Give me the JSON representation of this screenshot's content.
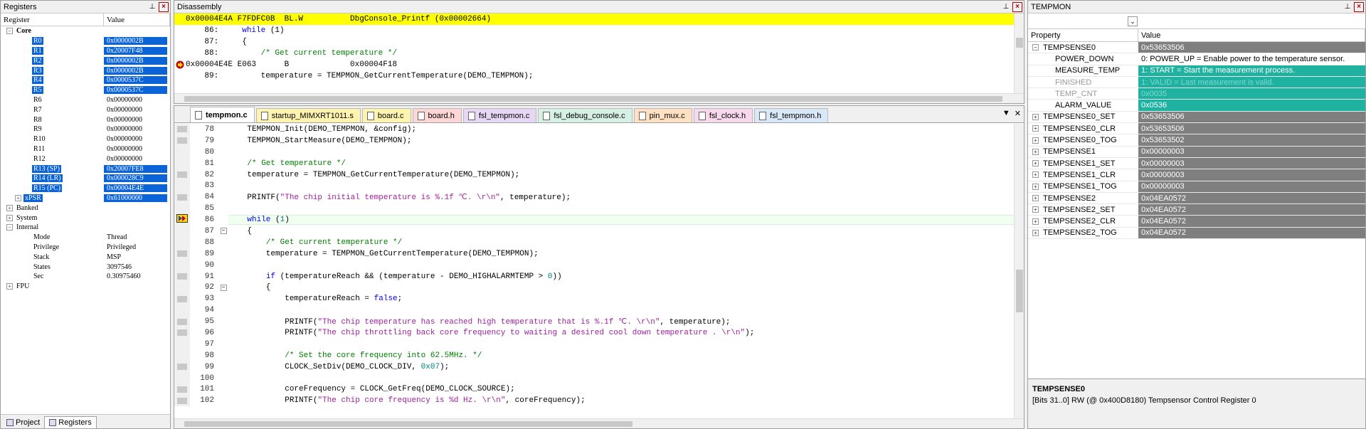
{
  "registers": {
    "title": "Registers",
    "col_register": "Register",
    "col_value": "Value",
    "rows": [
      {
        "name": "Core",
        "value": "",
        "level": 0,
        "expander": "−",
        "bold": true,
        "sel": false
      },
      {
        "name": "R0",
        "value": "0x0000002B",
        "level": 2,
        "expander": "",
        "sel": true
      },
      {
        "name": "R1",
        "value": "0x20007F48",
        "level": 2,
        "expander": "",
        "sel": true
      },
      {
        "name": "R2",
        "value": "0x0000002B",
        "level": 2,
        "expander": "",
        "sel": true
      },
      {
        "name": "R3",
        "value": "0x0000002B",
        "level": 2,
        "expander": "",
        "sel": true
      },
      {
        "name": "R4",
        "value": "0x0000537C",
        "level": 2,
        "expander": "",
        "sel": true
      },
      {
        "name": "R5",
        "value": "0x0000537C",
        "level": 2,
        "expander": "",
        "sel": true
      },
      {
        "name": "R6",
        "value": "0x00000000",
        "level": 2,
        "expander": "",
        "sel": false
      },
      {
        "name": "R7",
        "value": "0x00000000",
        "level": 2,
        "expander": "",
        "sel": false
      },
      {
        "name": "R8",
        "value": "0x00000000",
        "level": 2,
        "expander": "",
        "sel": false
      },
      {
        "name": "R9",
        "value": "0x00000000",
        "level": 2,
        "expander": "",
        "sel": false
      },
      {
        "name": "R10",
        "value": "0x00000000",
        "level": 2,
        "expander": "",
        "sel": false
      },
      {
        "name": "R11",
        "value": "0x00000000",
        "level": 2,
        "expander": "",
        "sel": false
      },
      {
        "name": "R12",
        "value": "0x00000000",
        "level": 2,
        "expander": "",
        "sel": false
      },
      {
        "name": "R13 (SP)",
        "value": "0x20007FE8",
        "level": 2,
        "expander": "",
        "sel": true
      },
      {
        "name": "R14 (LR)",
        "value": "0x000028C9",
        "level": 2,
        "expander": "",
        "sel": true
      },
      {
        "name": "R15 (PC)",
        "value": "0x00004E4E",
        "level": 2,
        "expander": "",
        "sel": true
      },
      {
        "name": "xPSR",
        "value": "0x61000000",
        "level": 1,
        "expander": "+",
        "sel": true
      },
      {
        "name": "Banked",
        "value": "",
        "level": 0,
        "expander": "+",
        "sel": false
      },
      {
        "name": "System",
        "value": "",
        "level": 0,
        "expander": "+",
        "sel": false
      },
      {
        "name": "Internal",
        "value": "",
        "level": 0,
        "expander": "−",
        "sel": false
      },
      {
        "name": "Mode",
        "value": "Thread",
        "level": 2,
        "expander": "",
        "sel": false
      },
      {
        "name": "Privilege",
        "value": "Privileged",
        "level": 2,
        "expander": "",
        "sel": false
      },
      {
        "name": "Stack",
        "value": "MSP",
        "level": 2,
        "expander": "",
        "sel": false
      },
      {
        "name": "States",
        "value": "3097546",
        "level": 2,
        "expander": "",
        "sel": false
      },
      {
        "name": "Sec",
        "value": "0.30975460",
        "level": 2,
        "expander": "",
        "sel": false
      },
      {
        "name": "FPU",
        "value": "",
        "level": 0,
        "expander": "+",
        "sel": false
      }
    ],
    "tab_project": "Project",
    "tab_registers": "Registers"
  },
  "disassembly": {
    "title": "Disassembly",
    "lines": [
      {
        "marker": "",
        "cur": true,
        "segments": [
          {
            "t": "0x00004E4A F7FDFC0B  BL.W          DbgConsole_Printf (0x00002664)",
            "c": ""
          }
        ]
      },
      {
        "marker": "",
        "cur": false,
        "segments": [
          {
            "t": "    86:     ",
            "c": ""
          },
          {
            "t": "while",
            "c": "kw"
          },
          {
            "t": " (1)",
            "c": ""
          }
        ]
      },
      {
        "marker": "",
        "cur": false,
        "segments": [
          {
            "t": "    87:     {",
            "c": ""
          }
        ]
      },
      {
        "marker": "",
        "cur": false,
        "segments": [
          {
            "t": "    88:         ",
            "c": ""
          },
          {
            "t": "/* Get current temperature */",
            "c": "cm"
          }
        ]
      },
      {
        "marker": "pc",
        "cur": false,
        "segments": [
          {
            "t": "0x00004E4E E063      B             0x00004F18",
            "c": ""
          }
        ]
      },
      {
        "marker": "",
        "cur": false,
        "segments": [
          {
            "t": "    89:         temperature = TEMPMON_GetCurrentTemperature(DEMO_TEMPMON);",
            "c": ""
          }
        ]
      }
    ]
  },
  "editor": {
    "tabs": [
      {
        "label": "tempmon.c",
        "color": "#ffffff",
        "active": true
      },
      {
        "label": "startup_MIMXRT1011.s",
        "color": "#fff3b0",
        "active": false
      },
      {
        "label": "board.c",
        "color": "#fff3b0",
        "active": false
      },
      {
        "label": "board.h",
        "color": "#ffd6d6",
        "active": false
      },
      {
        "label": "fsl_tempmon.c",
        "color": "#e6d8f5",
        "active": false
      },
      {
        "label": "fsl_debug_console.c",
        "color": "#d6f0e6",
        "active": false
      },
      {
        "label": "pin_mux.c",
        "color": "#ffe0c0",
        "active": false
      },
      {
        "label": "fsl_clock.h",
        "color": "#f8d8ec",
        "active": false
      },
      {
        "label": "fsl_tempmon.h",
        "color": "#d8e8f8",
        "active": false
      }
    ],
    "lines": [
      {
        "n": "78",
        "bp": true,
        "fold": "",
        "hl": false,
        "arrow": false,
        "segments": [
          {
            "t": "    TEMPMON_Init(DEMO_TEMPMON, &config);",
            "c": ""
          }
        ]
      },
      {
        "n": "79",
        "bp": true,
        "fold": "",
        "hl": false,
        "arrow": false,
        "segments": [
          {
            "t": "    TEMPMON_StartMeasure(DEMO_TEMPMON);",
            "c": ""
          }
        ]
      },
      {
        "n": "80",
        "bp": false,
        "fold": "",
        "hl": false,
        "arrow": false,
        "segments": [
          {
            "t": "",
            "c": ""
          }
        ]
      },
      {
        "n": "81",
        "bp": false,
        "fold": "",
        "hl": false,
        "arrow": false,
        "segments": [
          {
            "t": "    ",
            "c": ""
          },
          {
            "t": "/* Get temperature */",
            "c": "cm"
          }
        ]
      },
      {
        "n": "82",
        "bp": true,
        "fold": "",
        "hl": false,
        "arrow": false,
        "segments": [
          {
            "t": "    temperature = TEMPMON_GetCurrentTemperature(DEMO_TEMPMON);",
            "c": ""
          }
        ]
      },
      {
        "n": "83",
        "bp": false,
        "fold": "",
        "hl": false,
        "arrow": false,
        "segments": [
          {
            "t": "",
            "c": ""
          }
        ]
      },
      {
        "n": "84",
        "bp": true,
        "fold": "",
        "hl": false,
        "arrow": false,
        "segments": [
          {
            "t": "    PRINTF(",
            "c": ""
          },
          {
            "t": "\"The chip initial temperature is %.1f ℃. \\r\\n\"",
            "c": "st"
          },
          {
            "t": ", temperature);",
            "c": ""
          }
        ]
      },
      {
        "n": "85",
        "bp": false,
        "fold": "",
        "hl": false,
        "arrow": false,
        "segments": [
          {
            "t": "",
            "c": ""
          }
        ]
      },
      {
        "n": "86",
        "bp": false,
        "fold": "",
        "hl": true,
        "arrow": true,
        "segments": [
          {
            "t": "    ",
            "c": ""
          },
          {
            "t": "while",
            "c": "kw"
          },
          {
            "t": " (",
            "c": ""
          },
          {
            "t": "1",
            "c": "nm"
          },
          {
            "t": ")",
            "c": ""
          }
        ]
      },
      {
        "n": "87",
        "bp": false,
        "fold": "−",
        "hl": false,
        "arrow": false,
        "segments": [
          {
            "t": "    {",
            "c": ""
          }
        ]
      },
      {
        "n": "88",
        "bp": false,
        "fold": "",
        "hl": false,
        "arrow": false,
        "segments": [
          {
            "t": "        ",
            "c": ""
          },
          {
            "t": "/* Get current temperature */",
            "c": "cm"
          }
        ]
      },
      {
        "n": "89",
        "bp": true,
        "fold": "",
        "hl": false,
        "arrow": false,
        "segments": [
          {
            "t": "        temperature = TEMPMON_GetCurrentTemperature(DEMO_TEMPMON);",
            "c": ""
          }
        ]
      },
      {
        "n": "90",
        "bp": false,
        "fold": "",
        "hl": false,
        "arrow": false,
        "segments": [
          {
            "t": "",
            "c": ""
          }
        ]
      },
      {
        "n": "91",
        "bp": true,
        "fold": "",
        "hl": false,
        "arrow": false,
        "segments": [
          {
            "t": "        ",
            "c": ""
          },
          {
            "t": "if",
            "c": "kw"
          },
          {
            "t": " (temperatureReach && (temperature - DEMO_HIGHALARMTEMP > ",
            "c": ""
          },
          {
            "t": "0",
            "c": "nm"
          },
          {
            "t": "))",
            "c": ""
          }
        ]
      },
      {
        "n": "92",
        "bp": false,
        "fold": "−",
        "hl": false,
        "arrow": false,
        "segments": [
          {
            "t": "        {",
            "c": ""
          }
        ]
      },
      {
        "n": "93",
        "bp": true,
        "fold": "",
        "hl": false,
        "arrow": false,
        "segments": [
          {
            "t": "            temperatureReach = ",
            "c": ""
          },
          {
            "t": "false",
            "c": "kw"
          },
          {
            "t": ";",
            "c": ""
          }
        ]
      },
      {
        "n": "94",
        "bp": false,
        "fold": "",
        "hl": false,
        "arrow": false,
        "segments": [
          {
            "t": "",
            "c": ""
          }
        ]
      },
      {
        "n": "95",
        "bp": true,
        "fold": "",
        "hl": false,
        "arrow": false,
        "segments": [
          {
            "t": "            PRINTF(",
            "c": ""
          },
          {
            "t": "\"The chip temperature has reached high temperature that is %.1f ℃. \\r\\n\"",
            "c": "st"
          },
          {
            "t": ", temperature);",
            "c": ""
          }
        ]
      },
      {
        "n": "96",
        "bp": true,
        "fold": "",
        "hl": false,
        "arrow": false,
        "segments": [
          {
            "t": "            PRINTF(",
            "c": ""
          },
          {
            "t": "\"The chip throttling back core frequency to waiting a desired cool down temperature . \\r\\n\"",
            "c": "st"
          },
          {
            "t": ");",
            "c": ""
          }
        ]
      },
      {
        "n": "97",
        "bp": false,
        "fold": "",
        "hl": false,
        "arrow": false,
        "segments": [
          {
            "t": "",
            "c": ""
          }
        ]
      },
      {
        "n": "98",
        "bp": false,
        "fold": "",
        "hl": false,
        "arrow": false,
        "segments": [
          {
            "t": "            ",
            "c": ""
          },
          {
            "t": "/* Set the core frequency into 62.5MHz. */",
            "c": "cm"
          }
        ]
      },
      {
        "n": "99",
        "bp": true,
        "fold": "",
        "hl": false,
        "arrow": false,
        "segments": [
          {
            "t": "            CLOCK_SetDiv(DEMO_CLOCK_DIV, ",
            "c": ""
          },
          {
            "t": "0x07",
            "c": "nm"
          },
          {
            "t": ");",
            "c": ""
          }
        ]
      },
      {
        "n": "100",
        "bp": false,
        "fold": "",
        "hl": false,
        "arrow": false,
        "segments": [
          {
            "t": "",
            "c": ""
          }
        ]
      },
      {
        "n": "101",
        "bp": true,
        "fold": "",
        "hl": false,
        "arrow": false,
        "segments": [
          {
            "t": "            coreFrequency = CLOCK_GetFreq(DEMO_CLOCK_SOURCE);",
            "c": ""
          }
        ]
      },
      {
        "n": "102",
        "bp": true,
        "fold": "",
        "hl": false,
        "arrow": false,
        "segments": [
          {
            "t": "            PRINTF(",
            "c": ""
          },
          {
            "t": "\"The chip core frequency is %d Hz. \\r\\n\"",
            "c": "st"
          },
          {
            "t": ", coreFrequency);",
            "c": ""
          }
        ]
      }
    ]
  },
  "tempmon": {
    "title": "TEMPMON",
    "col_property": "Property",
    "col_value": "Value",
    "rows": [
      {
        "prop": "TEMPSENSE0",
        "value": "0x53653506",
        "expander": "−",
        "child": false,
        "style": "grey",
        "dim": false
      },
      {
        "prop": "POWER_DOWN",
        "value": "0: POWER_UP = Enable power to the temperature sensor.",
        "expander": "",
        "child": true,
        "style": "white",
        "dim": false
      },
      {
        "prop": "MEASURE_TEMP",
        "value": "1: START = Start the measurement process.",
        "expander": "",
        "child": true,
        "style": "teal",
        "dim": false
      },
      {
        "prop": "FINISHED",
        "value": "1: VALID = Last measurement is valid.",
        "expander": "",
        "child": true,
        "style": "teal dim",
        "dim": true
      },
      {
        "prop": "TEMP_CNT",
        "value": "0x0035",
        "expander": "",
        "child": true,
        "style": "teal dim",
        "dim": true
      },
      {
        "prop": "ALARM_VALUE",
        "value": "0x0536",
        "expander": "",
        "child": true,
        "style": "teal",
        "dim": false
      },
      {
        "prop": "TEMPSENSE0_SET",
        "value": "0x53653506",
        "expander": "+",
        "child": false,
        "style": "grey",
        "dim": false
      },
      {
        "prop": "TEMPSENSE0_CLR",
        "value": "0x53653506",
        "expander": "+",
        "child": false,
        "style": "grey",
        "dim": false
      },
      {
        "prop": "TEMPSENSE0_TOG",
        "value": "0x53653502",
        "expander": "+",
        "child": false,
        "style": "grey",
        "dim": false
      },
      {
        "prop": "TEMPSENSE1",
        "value": "0x00000003",
        "expander": "+",
        "child": false,
        "style": "grey",
        "dim": false
      },
      {
        "prop": "TEMPSENSE1_SET",
        "value": "0x00000003",
        "expander": "+",
        "child": false,
        "style": "grey",
        "dim": false
      },
      {
        "prop": "TEMPSENSE1_CLR",
        "value": "0x00000003",
        "expander": "+",
        "child": false,
        "style": "grey",
        "dim": false
      },
      {
        "prop": "TEMPSENSE1_TOG",
        "value": "0x00000003",
        "expander": "+",
        "child": false,
        "style": "grey",
        "dim": false
      },
      {
        "prop": "TEMPSENSE2",
        "value": "0x04EA0572",
        "expander": "+",
        "child": false,
        "style": "grey",
        "dim": false
      },
      {
        "prop": "TEMPSENSE2_SET",
        "value": "0x04EA0572",
        "expander": "+",
        "child": false,
        "style": "grey",
        "dim": false
      },
      {
        "prop": "TEMPSENSE2_CLR",
        "value": "0x04EA0572",
        "expander": "+",
        "child": false,
        "style": "grey",
        "dim": false
      },
      {
        "prop": "TEMPSENSE2_TOG",
        "value": "0x04EA0572",
        "expander": "+",
        "child": false,
        "style": "grey",
        "dim": false
      }
    ],
    "desc_title": "TEMPSENSE0",
    "desc_text": "[Bits 31..0] RW (@ 0x400D8180) Tempsensor Control Register 0"
  }
}
